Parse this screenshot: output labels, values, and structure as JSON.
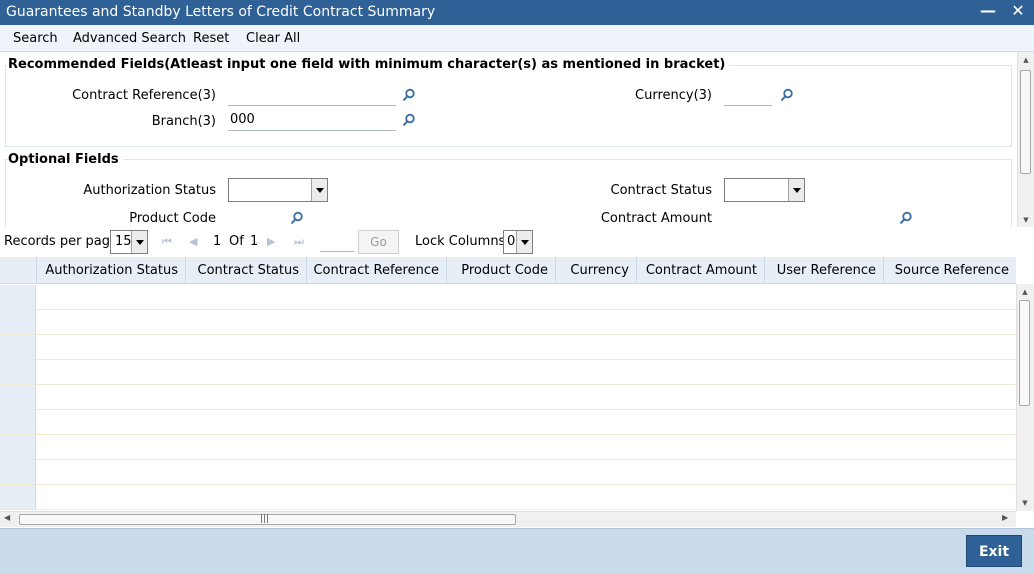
{
  "window": {
    "title": "Guarantees and Standby Letters of Credit Contract Summary",
    "minimize_glyph": "—",
    "close_glyph": "✕"
  },
  "toolbar": {
    "search": "Search",
    "advanced_search": "Advanced Search",
    "reset": "Reset",
    "clear_all": "Clear All"
  },
  "recommended": {
    "title": "Recommended Fields(Atleast input one field with minimum character(s) as mentioned in bracket)",
    "contract_reference_label": "Contract Reference(3)",
    "contract_reference_value": "",
    "currency_label": "Currency(3)",
    "currency_value": "",
    "branch_label": "Branch(3)",
    "branch_value": "000"
  },
  "optional": {
    "title": "Optional Fields",
    "authorization_status_label": "Authorization Status",
    "authorization_status_value": "",
    "contract_status_label": "Contract Status",
    "contract_status_value": "",
    "product_code_label": "Product Code",
    "contract_amount_label": "Contract Amount"
  },
  "pager": {
    "records_per_page_label": "Records per page",
    "records_per_page_value": "15",
    "current_page": "1",
    "of_label": "Of",
    "total_pages": "1",
    "go_label": "Go",
    "lock_columns_label": "Lock Columns",
    "lock_columns_value": "0"
  },
  "grid": {
    "columns": [
      "Authorization Status",
      "Contract Status",
      "Contract Reference",
      "Product Code",
      "Currency",
      "Contract Amount",
      "User Reference",
      "Source Reference"
    ]
  },
  "footer": {
    "exit_label": "Exit"
  },
  "colors": {
    "titlebar": "#2f6196",
    "toolbar": "#eff4fa",
    "footer": "#c9daec",
    "search_icon": "#3b6ea5"
  }
}
